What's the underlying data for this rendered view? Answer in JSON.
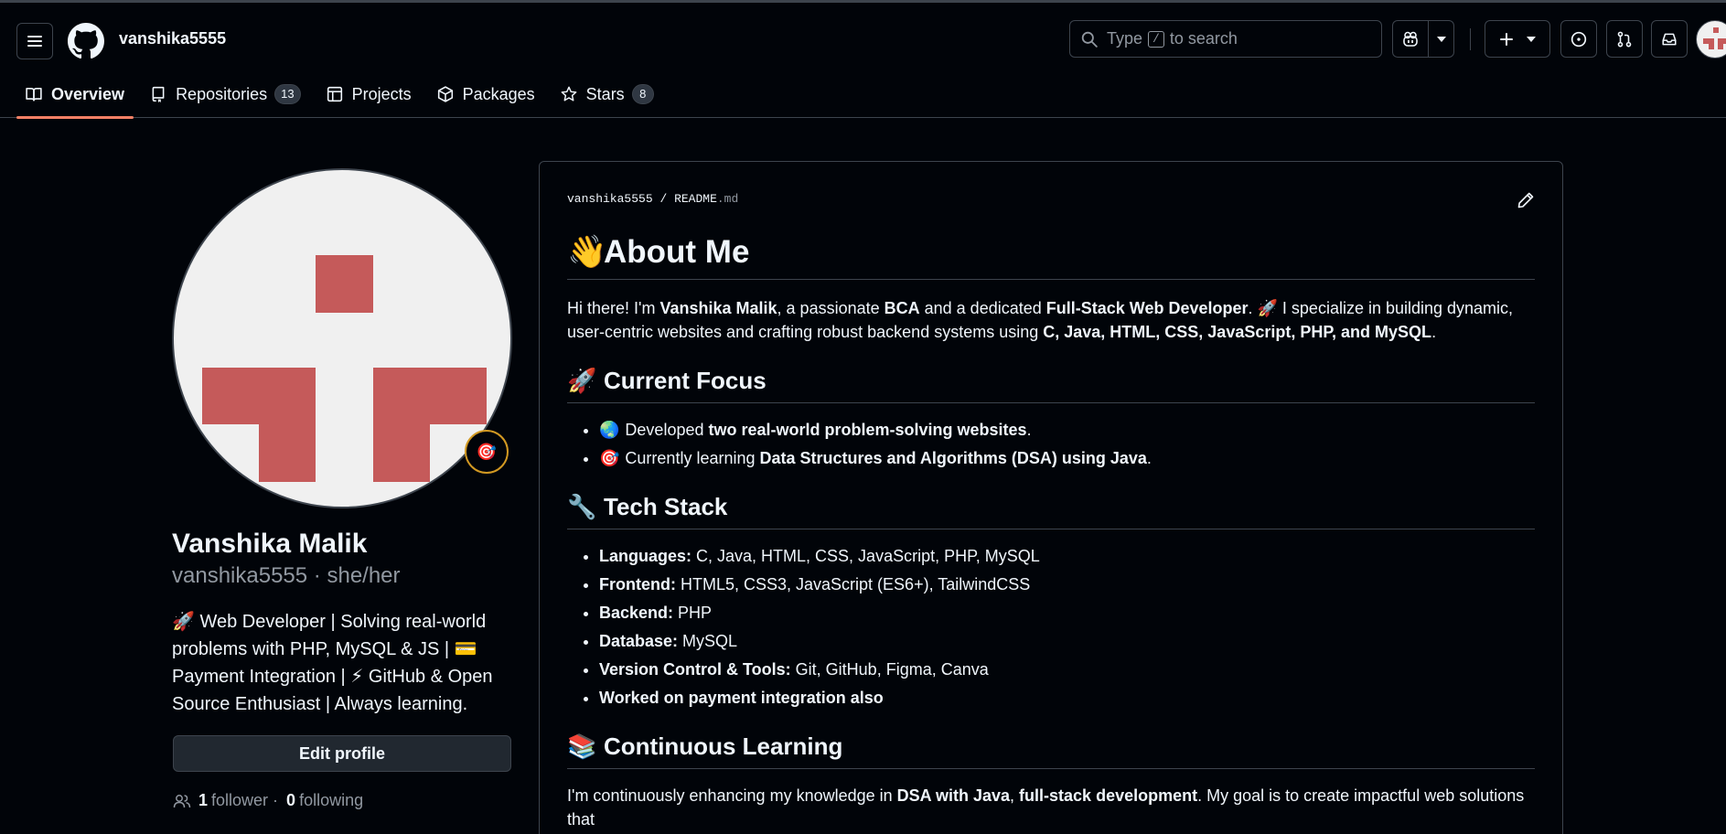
{
  "header": {
    "owner": "vanshika5555",
    "search": {
      "before": "Type",
      "key": "/",
      "after": "to search"
    }
  },
  "tabs": [
    {
      "label": "Overview",
      "count": null,
      "icon": "book-icon"
    },
    {
      "label": "Repositories",
      "count": "13",
      "icon": "repo-icon"
    },
    {
      "label": "Projects",
      "count": null,
      "icon": "table-icon"
    },
    {
      "label": "Packages",
      "count": null,
      "icon": "package-icon"
    },
    {
      "label": "Stars",
      "count": "8",
      "icon": "star-icon"
    }
  ],
  "profile": {
    "status_emoji": "🎯",
    "name": "Vanshika Malik",
    "login": "vanshika5555",
    "separator": "·",
    "pronouns": "she/her",
    "bio": "🚀 Web Developer | Solving real-world problems with PHP, MySQL & JS | 💳 Payment Integration | ⚡ GitHub & Open Source Enthusiast | Always learning.",
    "edit_button": "Edit profile",
    "followers_count": "1",
    "followers_label": "follower",
    "dot": "·",
    "following_count": "0",
    "following_label": "following"
  },
  "readme": {
    "path_owner": "vanshika5555",
    "path_sep": "/",
    "file_name": "README",
    "file_ext": ".md",
    "h1": {
      "emoji": "👋",
      "text": "About Me"
    },
    "intro": {
      "p1": "Hi there! I'm ",
      "b1": "Vanshika Malik",
      "p2": ", a passionate ",
      "b2": "BCA",
      "p3": " and a dedicated ",
      "b3": "Full-Stack Web Developer",
      "p4": ". 🚀 I specialize in building dynamic, user-centric websites and crafting robust backend systems using ",
      "b4": "C, Java, HTML, CSS, JavaScript, PHP, and MySQL",
      "p5": "."
    },
    "focus": {
      "emoji": "🚀",
      "title": "Current Focus",
      "items": [
        {
          "emoji": "🌏",
          "pre": "Developed ",
          "bold": "two real-world problem-solving websites",
          "post": "."
        },
        {
          "emoji": "🎯",
          "pre": "Currently learning ",
          "bold": "Data Structures and Algorithms (DSA) using Java",
          "post": "."
        }
      ]
    },
    "stack": {
      "emoji": "🔧",
      "title": "Tech Stack",
      "items": [
        {
          "bold": "Languages:",
          "text": " C, Java, HTML, CSS, JavaScript, PHP, MySQL"
        },
        {
          "bold": "Frontend:",
          "text": " HTML5, CSS3, JavaScript (ES6+), TailwindCSS"
        },
        {
          "bold": "Backend:",
          "text": " PHP"
        },
        {
          "bold": "Database:",
          "text": " MySQL"
        },
        {
          "bold": "Version Control & Tools:",
          "text": " Git, GitHub, Figma, Canva"
        },
        {
          "bold": "Worked on payment integration also",
          "text": ""
        }
      ]
    },
    "learning": {
      "emoji": "📚",
      "title": "Continuous Learning",
      "p1": "I'm continuously enhancing my knowledge in ",
      "b1": "DSA with Java",
      "p2": ", ",
      "b2": "full-stack development",
      "p3": ". My goal is to create impactful web solutions that"
    }
  },
  "colors": {
    "background": "#010409",
    "border": "#3d444d",
    "text": "#f0f6fc",
    "muted": "#9198a1",
    "tab_underline": "#f78166",
    "identicon": "#c55a5a"
  }
}
